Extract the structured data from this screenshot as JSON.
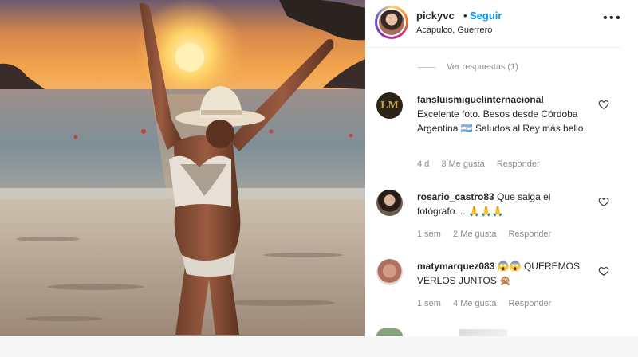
{
  "post": {
    "username": "pickyvc",
    "separator": "•",
    "follow_label": "Seguir",
    "location": "Acapulco, Guerrero",
    "more_label": "• • •"
  },
  "view_replies": "Ver respuestas (1)",
  "comments": [
    {
      "username": "fansluismiguelinternacional",
      "avatar_text": "LM",
      "text": "Excelente foto. Besos desde Córdoba Argentina 🇦🇷 Saludos al Rey más bello.",
      "time": "4 d",
      "likes": "3 Me gusta",
      "reply": "Responder"
    },
    {
      "username": "rosario_castro83",
      "text": "Que salga el fotógrafo.... 🙏🙏🙏",
      "time": "1 sem",
      "likes": "2 Me gusta",
      "reply": "Responder"
    },
    {
      "username": "matymarquez083",
      "text": "😱😱 QUEREMOS VERLOS JUNTOS 🙊",
      "time": "1 sem",
      "likes": "4 Me gusta",
      "reply": "Responder"
    }
  ],
  "colors": {
    "follow": "#0095f6",
    "text": "#262626",
    "secondary": "#8e8e8e"
  }
}
